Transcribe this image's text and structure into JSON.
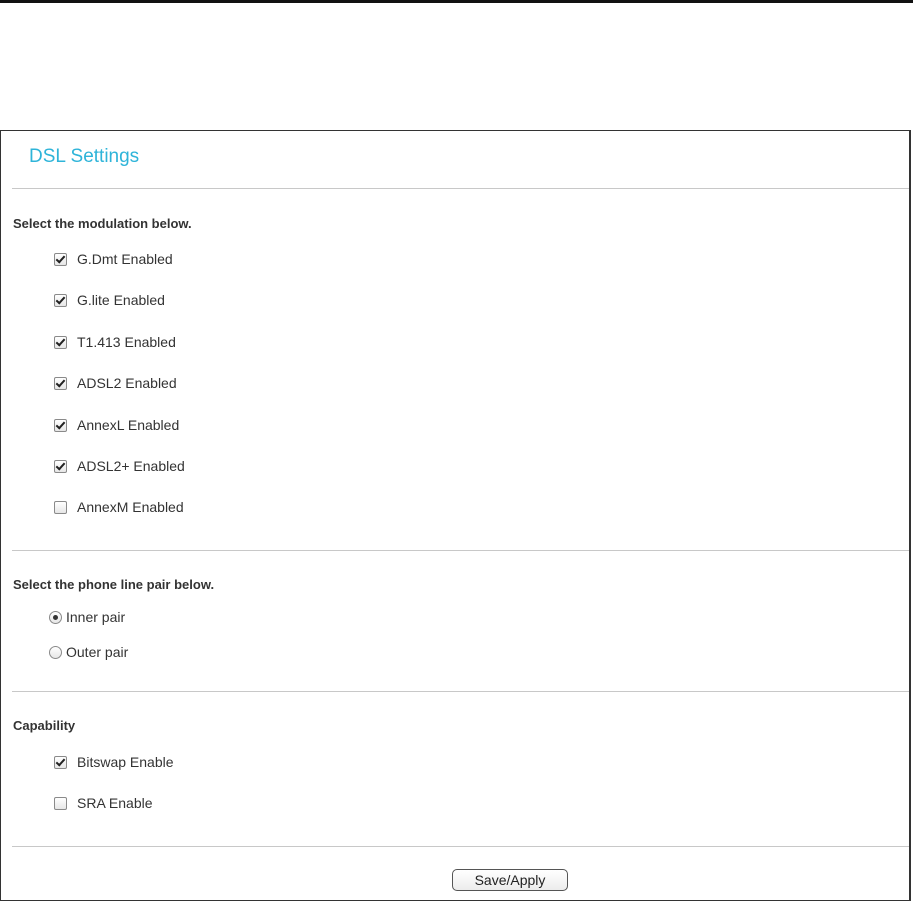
{
  "page": {
    "title": "DSL Settings"
  },
  "modulation": {
    "heading": "Select the modulation below.",
    "options": [
      {
        "label": "G.Dmt Enabled",
        "checked": true
      },
      {
        "label": "G.lite Enabled",
        "checked": true
      },
      {
        "label": "T1.413 Enabled",
        "checked": true
      },
      {
        "label": "ADSL2 Enabled",
        "checked": true
      },
      {
        "label": "AnnexL Enabled",
        "checked": true
      },
      {
        "label": "ADSL2+ Enabled",
        "checked": true
      },
      {
        "label": "AnnexM Enabled",
        "checked": false
      }
    ]
  },
  "phone_line": {
    "heading": "Select the phone line pair below.",
    "options": [
      {
        "label": "Inner pair",
        "selected": true
      },
      {
        "label": "Outer pair",
        "selected": false
      }
    ]
  },
  "capability": {
    "heading": "Capability",
    "options": [
      {
        "label": "Bitswap Enable",
        "checked": true
      },
      {
        "label": "SRA Enable",
        "checked": false
      }
    ]
  },
  "actions": {
    "save_label": "Save/Apply"
  },
  "colors": {
    "title": "#2eb4d9",
    "text": "#333333",
    "separator": "#c8c8c8"
  }
}
